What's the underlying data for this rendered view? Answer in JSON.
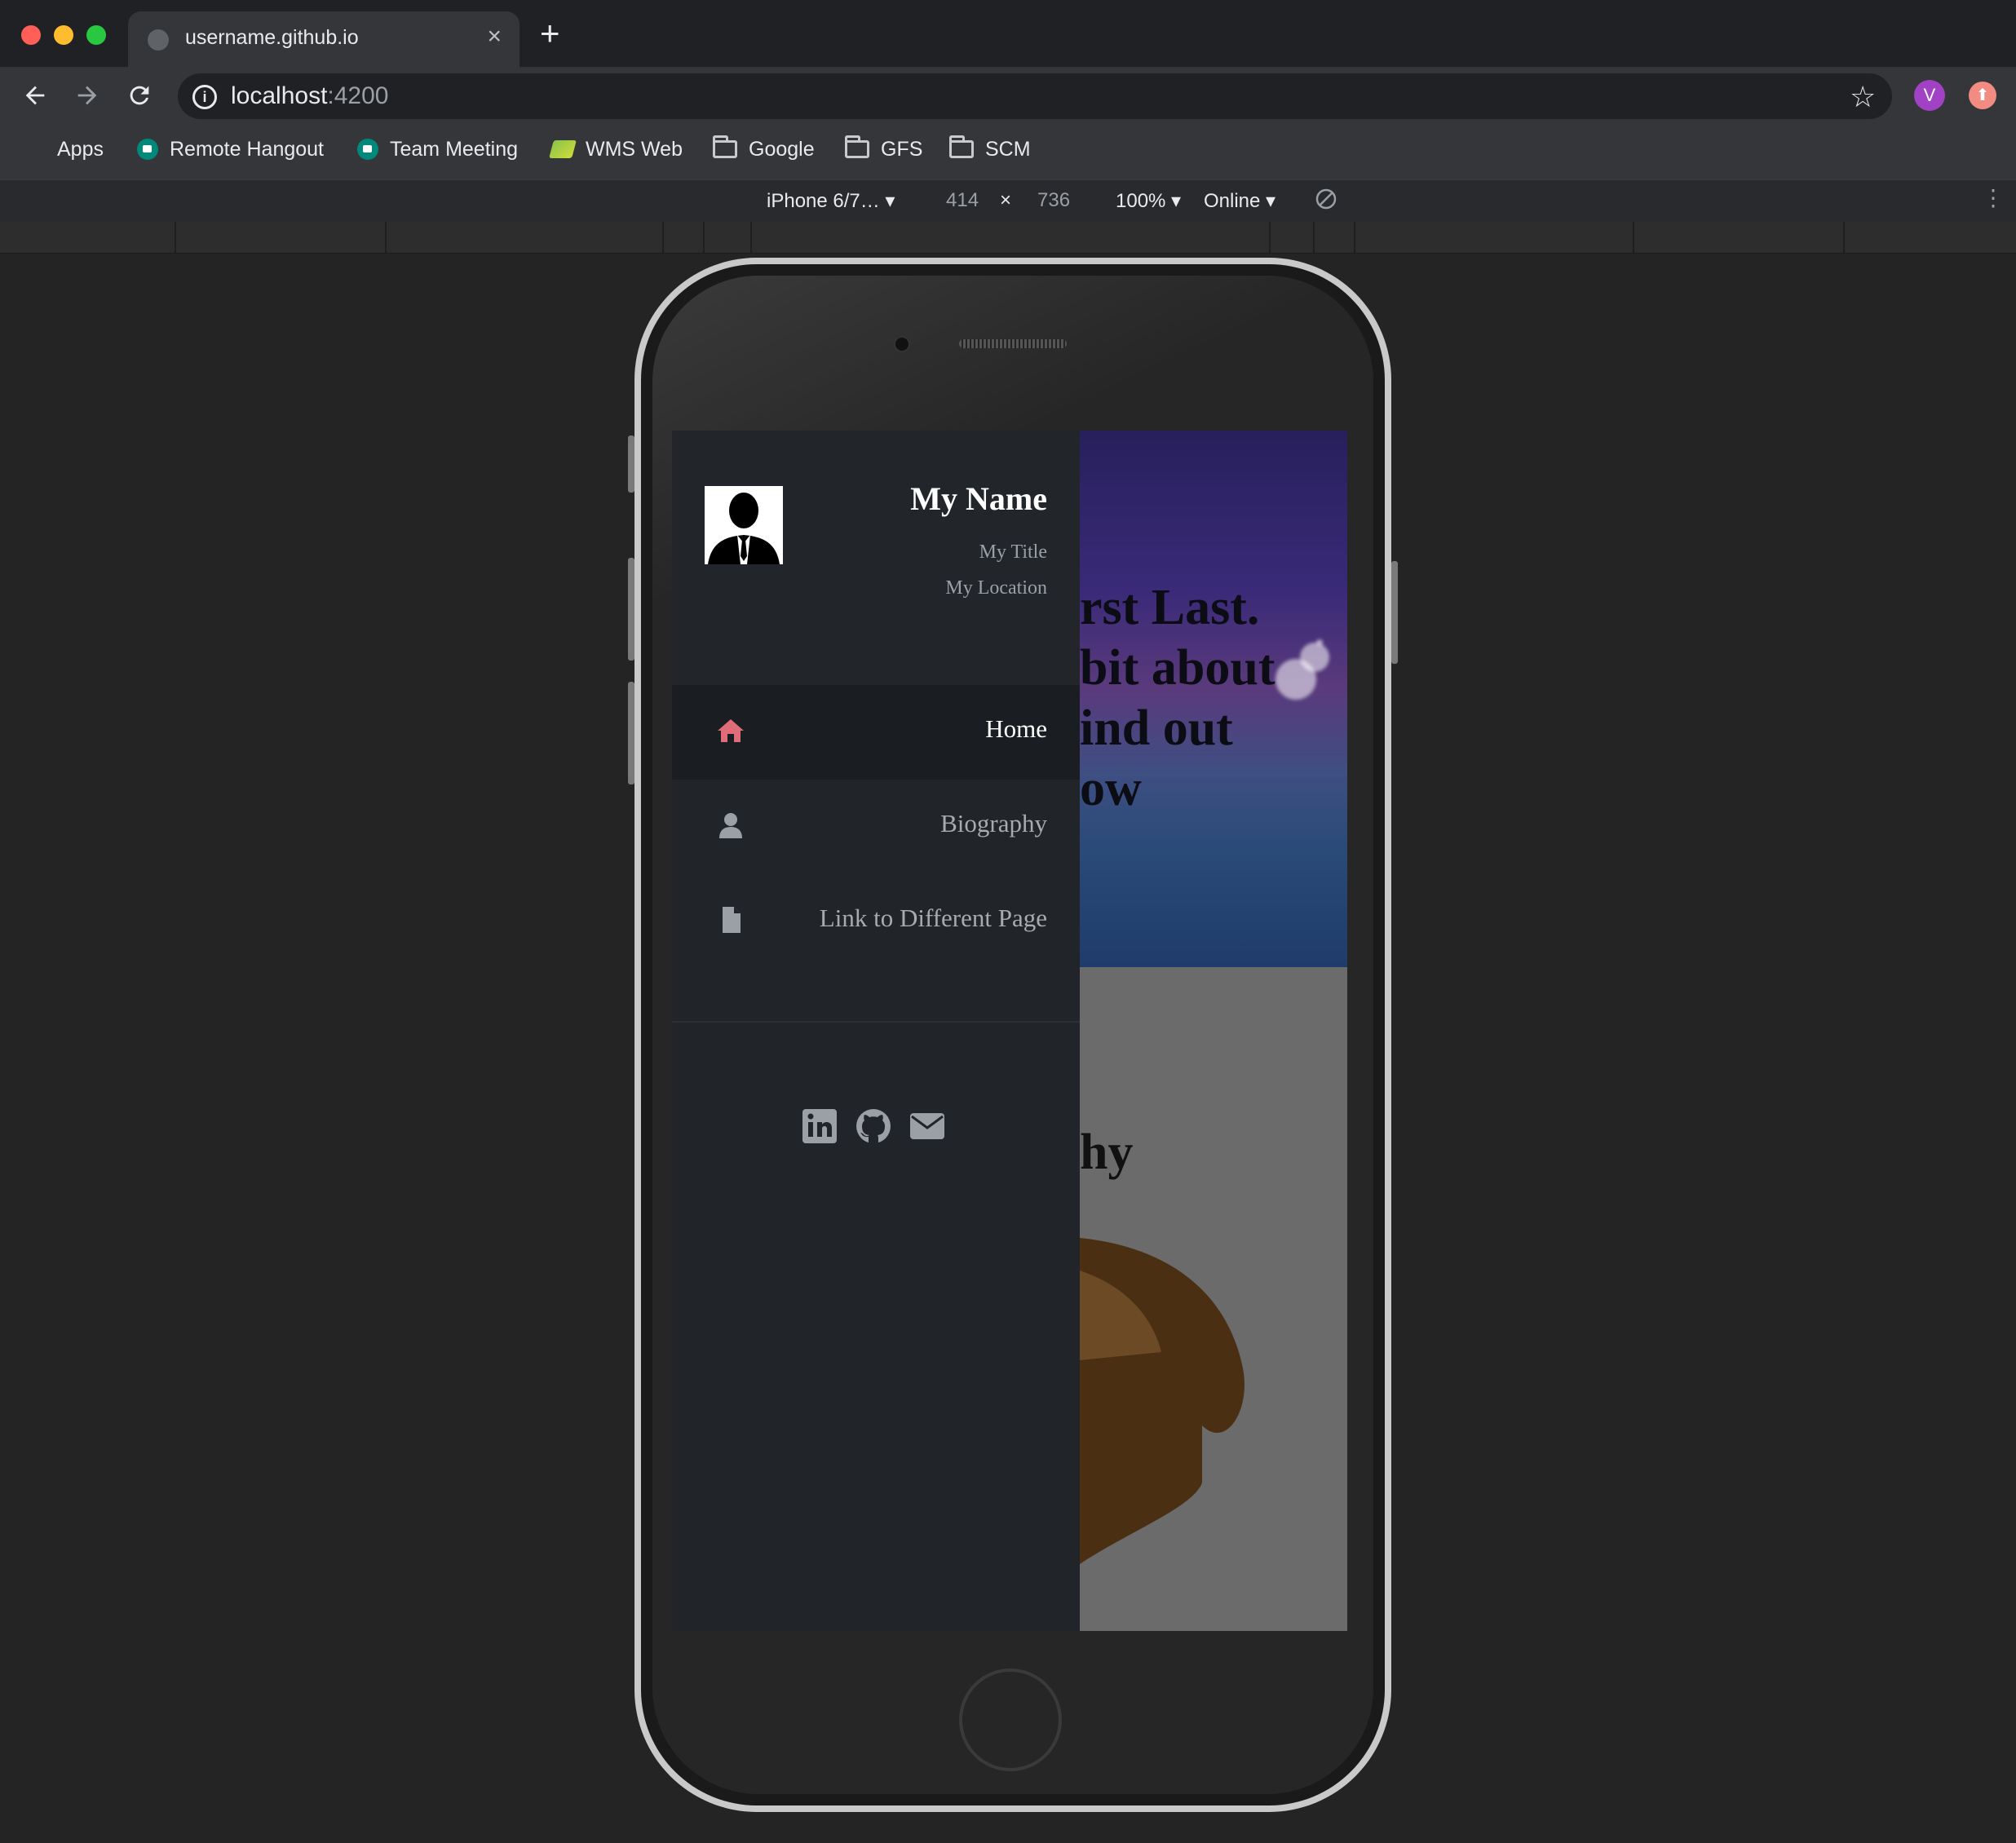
{
  "browser": {
    "tab_title": "username.github.io",
    "tab_close": "×",
    "new_tab": "+",
    "url_host": "localhost",
    "url_port": ":4200",
    "profile_initial": "V",
    "bookmarks": [
      {
        "label": "Apps",
        "icon": "apps-grid-icon"
      },
      {
        "label": "Remote Hangout",
        "icon": "google-meet-icon"
      },
      {
        "label": "Team Meeting",
        "icon": "google-meet-icon"
      },
      {
        "label": "WMS Web",
        "icon": "wms-icon"
      },
      {
        "label": "Google",
        "icon": "folder-icon"
      },
      {
        "label": "GFS",
        "icon": "folder-icon"
      },
      {
        "label": "SCM",
        "icon": "folder-icon"
      }
    ]
  },
  "devtools": {
    "device": "iPhone 6/7…",
    "width": "414",
    "times": "×",
    "height": "736",
    "zoom": "100%",
    "network": "Online"
  },
  "site": {
    "profile": {
      "name": "My Name",
      "title": "My Title",
      "location": "My Location"
    },
    "nav": [
      {
        "label": "Home",
        "icon": "home-icon",
        "active": true
      },
      {
        "label": "Biography",
        "icon": "user-icon",
        "active": false
      },
      {
        "label": "Link to Different Page",
        "icon": "file-icon",
        "active": false
      }
    ],
    "social": [
      "linkedin-icon",
      "github-icon",
      "envelope-icon"
    ],
    "hero_text": "rst Last.\nbit about\nind out\now",
    "bio_heading": "hy"
  },
  "colors": {
    "accent": "#e06c7a",
    "sidenav_bg": "#212529",
    "chrome_bg": "#202124"
  }
}
